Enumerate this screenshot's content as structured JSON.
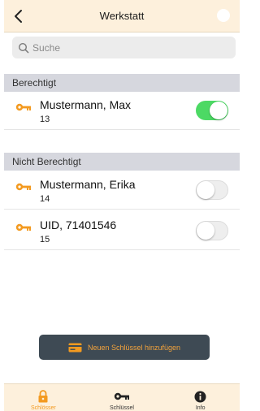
{
  "colors": {
    "accent": "#f39a20",
    "toggle_on": "#4cd964",
    "navbar_bg": "#fdf0dc",
    "section_bg": "#d6d7de",
    "button_bg": "#3e4a54"
  },
  "header": {
    "title": "Werkstatt",
    "back_icon": "chevron-left-icon"
  },
  "search": {
    "placeholder": "Suche",
    "value": ""
  },
  "sections": {
    "authorized": {
      "title": "Berechtigt",
      "items": [
        {
          "name": "Mustermann, Max",
          "sub": "13",
          "enabled": true
        }
      ]
    },
    "unauthorized": {
      "title": "Nicht Berechtigt",
      "items": [
        {
          "name": "Mustermann, Erika",
          "sub": "14",
          "enabled": false
        },
        {
          "name": "UID, 71401546",
          "sub": "15",
          "enabled": false
        }
      ]
    }
  },
  "add_button": {
    "label": "Neuen Schlüssel hinzufügen",
    "icon": "card-icon"
  },
  "tabs": [
    {
      "label": "Schlösser",
      "icon": "lock-icon",
      "active": true
    },
    {
      "label": "Schlüssel",
      "icon": "key-icon",
      "active": false
    },
    {
      "label": "Info",
      "icon": "info-icon",
      "active": false
    }
  ]
}
